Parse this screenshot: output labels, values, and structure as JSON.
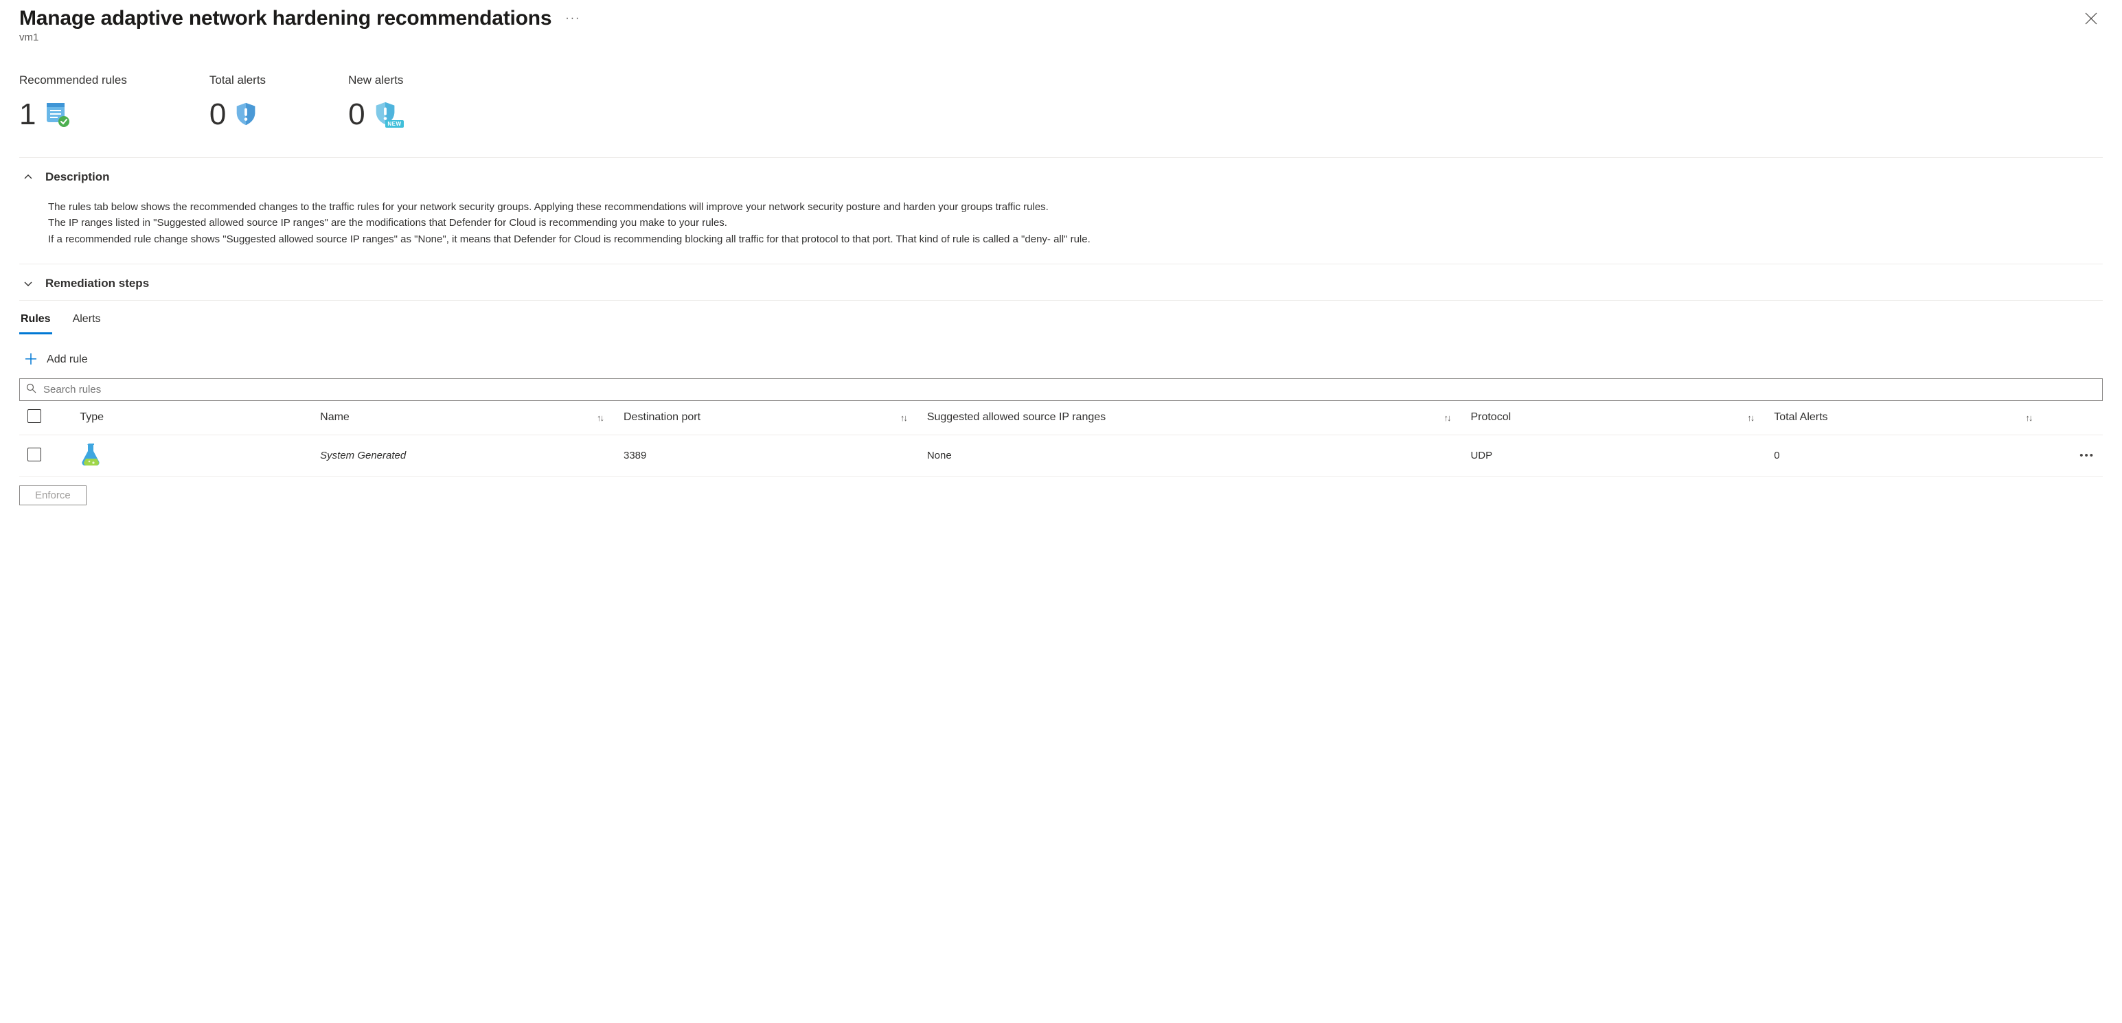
{
  "header": {
    "title": "Manage adaptive network hardening recommendations",
    "subtitle": "vm1",
    "more_label": "···",
    "close_label": "✕"
  },
  "metrics": {
    "recommended": {
      "label": "Recommended rules",
      "value": "1"
    },
    "total_alerts": {
      "label": "Total alerts",
      "value": "0"
    },
    "new_alerts": {
      "label": "New alerts",
      "value": "0",
      "badge": "NEW"
    }
  },
  "description": {
    "title": "Description",
    "p1": "The rules tab below shows the recommended changes to the traffic rules for your network security groups. Applying these recommendations will improve your network security posture and harden your groups traffic rules.",
    "p2": "The IP ranges listed in \"Suggested allowed source IP ranges\" are the modifications that Defender for Cloud is recommending you make to your rules.",
    "p3": "If a recommended rule change shows \"Suggested allowed source IP ranges\" as \"None\", it means that Defender for Cloud is recommending blocking all traffic for that protocol to that port. That kind of rule is called a \"deny- all\" rule."
  },
  "remediation": {
    "title": "Remediation steps"
  },
  "tabs": {
    "rules": "Rules",
    "alerts": "Alerts"
  },
  "toolbar": {
    "add_rule": "Add rule"
  },
  "search": {
    "placeholder": "Search rules"
  },
  "columns": {
    "type": "Type",
    "name": "Name",
    "port": "Destination port",
    "ip": "Suggested allowed source IP ranges",
    "protocol": "Protocol",
    "alerts": "Total Alerts"
  },
  "rows": [
    {
      "name": "System Generated",
      "port": "3389",
      "ip": "None",
      "protocol": "UDP",
      "alerts": "0"
    }
  ],
  "footer": {
    "enforce": "Enforce"
  }
}
